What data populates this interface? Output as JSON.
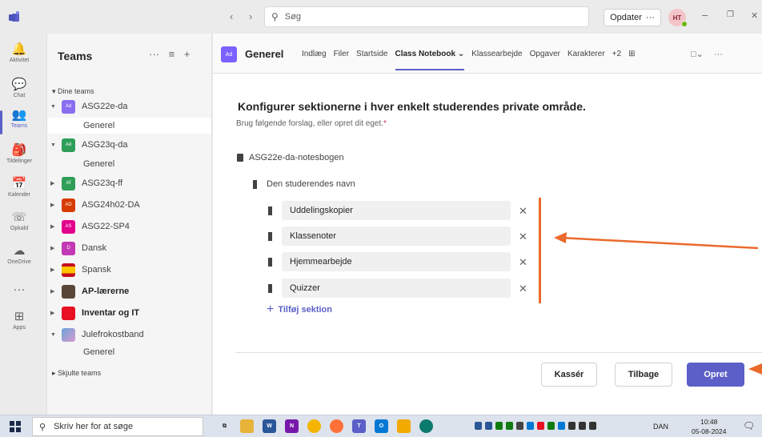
{
  "titlebar": {
    "nav_back": "‹",
    "nav_forward": "›",
    "search_placeholder": "Søg",
    "update_label": "Opdater",
    "update_more": "···",
    "avatar_initials": "HT",
    "minimize": "–",
    "restore": "❐",
    "close": "✕"
  },
  "rail": {
    "items": [
      {
        "label": "Aktivitet",
        "icon": "bell-icon",
        "glyph": "🔔"
      },
      {
        "label": "Chat",
        "icon": "chat-icon",
        "glyph": "💬"
      },
      {
        "label": "Teams",
        "icon": "teams-icon",
        "glyph": "👥"
      },
      {
        "label": "Tildelinger",
        "icon": "assignments-icon",
        "glyph": "🎒"
      },
      {
        "label": "Kalender",
        "icon": "calendar-icon",
        "glyph": "📅"
      },
      {
        "label": "Opkald",
        "icon": "phone-icon",
        "glyph": "☏"
      },
      {
        "label": "OneDrive",
        "icon": "cloud-icon",
        "glyph": "☁"
      },
      {
        "label": "",
        "icon": "more-icon",
        "glyph": "···"
      },
      {
        "label": "Apps",
        "icon": "apps-icon",
        "glyph": "⊞"
      }
    ]
  },
  "sidebar": {
    "title": "Teams",
    "more": "···",
    "filter": "≡",
    "add": "+",
    "section_label": "Dine teams",
    "hidden_label": "Skjulte teams",
    "teams": [
      {
        "name": "ASG22e-da",
        "tile": "Ad",
        "color": "#8a6ef0",
        "expanded": true,
        "channel": "Generel"
      },
      {
        "name": "ASG23q-da",
        "tile": "Ad",
        "color": "#2e9e58",
        "expanded": true,
        "channel": "Generel"
      },
      {
        "name": "ASG23q-ff",
        "tile": "Af",
        "color": "#2e9e58"
      },
      {
        "name": "ASG24h02-DA",
        "tile": "AD",
        "color": "#d83b01"
      },
      {
        "name": "ASG22-SP4",
        "tile": "AS",
        "color": "#e3008c"
      },
      {
        "name": "Dansk",
        "tile": "D",
        "color": "#c239b3"
      },
      {
        "name": "Spansk",
        "tile": "ES",
        "color": "#c50f1f"
      },
      {
        "name": "AP-lærerne",
        "tile": "AP",
        "color": "#8a6a4a",
        "bold": true
      },
      {
        "name": "Inventar og IT",
        "tile": "II",
        "color": "#e81123",
        "bold": true
      },
      {
        "name": "Julefrokostband",
        "tile": "JF",
        "color": "#6aa2d8",
        "expanded": true,
        "channel": "Generel"
      }
    ]
  },
  "header": {
    "tile": "Ad",
    "title": "Generel",
    "tabs": [
      "Indlæg",
      "Filer",
      "Startside",
      "Class Notebook ⌄",
      "Klassearbejde",
      "Opgaver",
      "Karakterer",
      "+2",
      "⊞"
    ],
    "tools": "□⌄ ···"
  },
  "content": {
    "heading": "Konfigurer sektionerne i hver enkelt studerendes private område.",
    "subheading": "Brug følgende forslag, eller opret dit eget.",
    "required_mark": "*",
    "notebook_name": "ASG22e-da-notesbogen",
    "student_name": "Den studerendes navn",
    "sections": [
      "Uddelingskopier",
      "Klassenoter",
      "Hjemmearbejde",
      "Quizzer"
    ],
    "add_section": "Tilføj sektion",
    "buttons": {
      "discard": "Kassér",
      "back": "Tilbage",
      "create": "Opret"
    }
  },
  "annotation": {
    "color": "#ea6a2c"
  },
  "taskbar": {
    "search_placeholder": "Skriv her for at søge",
    "language": "DAN",
    "time": "10:48",
    "date": "05-08-2024"
  }
}
